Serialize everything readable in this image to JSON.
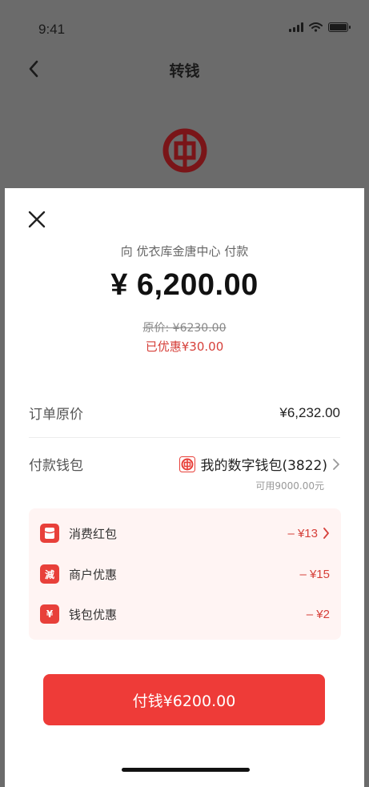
{
  "status_bar": {
    "time": "9:41"
  },
  "nav": {
    "title": "转钱"
  },
  "sheet": {
    "pay_to": "向 优衣库金唐中心 付款",
    "amount": "¥ 6,200.00",
    "original_price": "原价: ¥6230.00",
    "discount_total": "已优惠¥30.00",
    "order_row": {
      "label": "订单原价",
      "value": "¥6,232.00"
    },
    "wallet_row": {
      "label": "付款钱包",
      "value": "我的数字钱包(3822)",
      "available": "可用9000.00元"
    },
    "discounts": [
      {
        "icon": "red-packet-icon",
        "label": "消费红包",
        "value": "– ¥13",
        "has_chevron": true
      },
      {
        "icon": "merchant-discount-icon",
        "icon_text": "減",
        "label": "商户优惠",
        "value": "– ¥15",
        "has_chevron": false
      },
      {
        "icon": "wallet-discount-icon",
        "icon_text": "¥",
        "label": "钱包优惠",
        "value": "– ¥2",
        "has_chevron": false
      }
    ],
    "pay_button": "付钱¥6200.00"
  },
  "colors": {
    "accent_red": "#ee3b38",
    "discount_red": "#d6403a",
    "overlay_gray": "#6b6b6b",
    "discount_bg": "#fff4f3"
  }
}
